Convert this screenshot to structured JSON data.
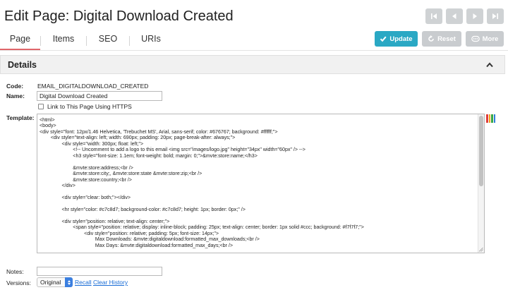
{
  "page": {
    "title": "Edit Page: Digital Download Created"
  },
  "icons": {
    "first": "first-page-icon",
    "prev": "previous-page-icon",
    "next": "next-page-icon",
    "last": "last-page-icon",
    "update": "checkmark-icon",
    "reset": "reset-icon",
    "more": "more-icon",
    "collapse": "chevron-up-icon",
    "editor": "editor-toggle-icon"
  },
  "colors": {
    "accent": "#2aa8c4",
    "tab_underline": "#e0666a",
    "link": "#1a6dd6"
  },
  "tabs": [
    {
      "label": "Page",
      "active": true
    },
    {
      "label": "Items"
    },
    {
      "label": "SEO"
    },
    {
      "label": "URIs"
    }
  ],
  "actions": {
    "update": "Update",
    "reset": "Reset",
    "more": "More"
  },
  "details": {
    "title": "Details",
    "code_label": "Code:",
    "code_value": "EMAIL_DIGITALDOWNLOAD_CREATED",
    "name_label": "Name:",
    "name_value": "Digital Download Created",
    "https_label": "Link to This Page Using HTTPS",
    "https_checked": false,
    "template_label": "Template:",
    "template_lines": [
      "<html>",
      "<body>",
      "<div style=\"font: 12px/1.46 Helvetica, 'Trebuchet MS', Arial, sans-serif; color: #676767; background: #ffffff;\">",
      "        <div style=\"text-align: left; width: 690px; padding: 20px; page-break-after: always;\">",
      "                <div style=\"width: 300px; float: left;\">",
      "                        <!-- Uncomment to add a logo to this email <img src=\"images/logo.jpg\" height=\"34px\" width=\"60px\" /> -->",
      "                        <h3 style=\"font-size: 1.1em; font-weight: bold; margin: 0;\">&mvte:store:name;</h3>",
      "",
      "                        &mvte:store:address;<br />",
      "                        &mvte:store:city;, &mvte:store:state &mvte:store:zip;<br />",
      "                        &mvte:store:country;<br />",
      "                </div>",
      "",
      "                <div style=\"clear: both;\"></div>",
      "",
      "                <hr style=\"color: #c7c8d7; background-color: #c7c8d7; height: 1px; border: 0px;\" />",
      "",
      "                <div style=\"position: relative; text-align: center;\">",
      "                        <span style=\"position: relative; display: inline-block; padding: 25px; text-align: center; border: 1px solid #ccc; background: #f7f7f7;\">",
      "                                <div style=\"position: relative; padding: 5px; font-size: 14px;\">",
      "                                        Max Downloads: &mvte:digitaldownload:formatted_max_downloads;<br />",
      "                                        Max Days: &mvte:digitaldownload:formatted_max_days;<br />"
    ],
    "notes_label": "Notes:",
    "notes_value": "",
    "versions_label": "Versions:",
    "versions_selected": "Original",
    "recall_link": "Recall",
    "clear_history_link": "Clear History"
  }
}
